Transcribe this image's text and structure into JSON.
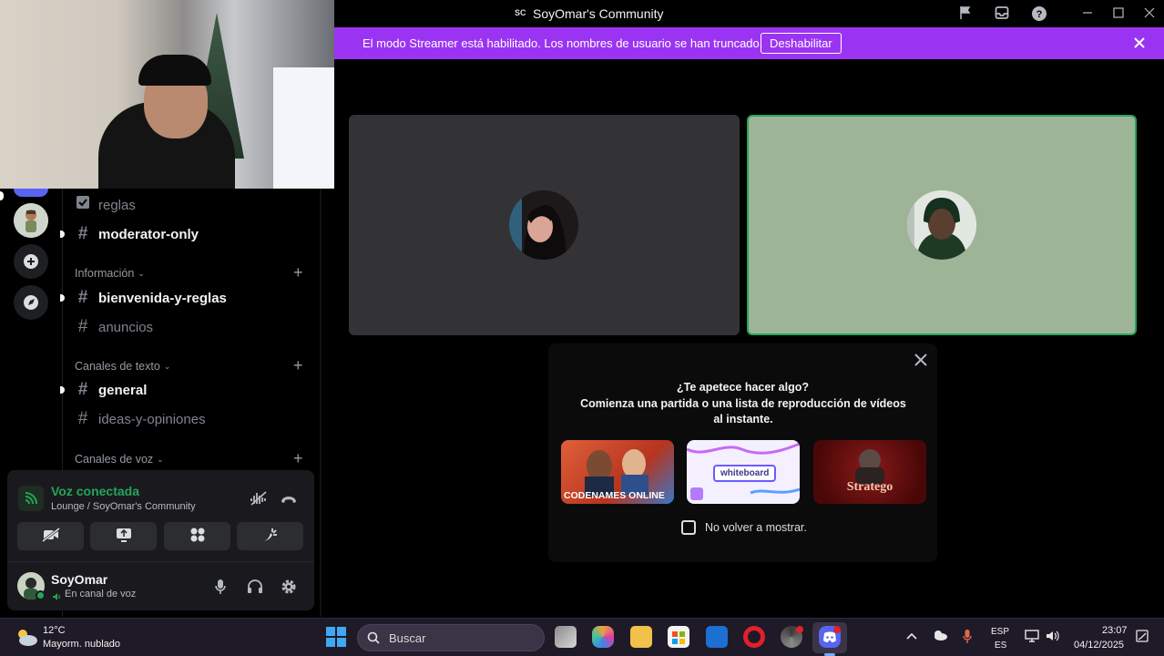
{
  "window": {
    "server_badge": "SC",
    "title": "SoyOmar's Community",
    "icons": [
      "flag-icon",
      "inbox-icon",
      "help-icon",
      "minimize-icon",
      "maximize-icon",
      "close-icon"
    ]
  },
  "banner": {
    "message": "El modo Streamer está habilitado. Los nombres de usuario se han truncado.",
    "button": "Deshabilitar",
    "close_icon": "close-icon"
  },
  "channels": {
    "top_items": [
      {
        "name": "reglas",
        "icon": "rules-icon",
        "unread": false
      },
      {
        "name": "moderator-only",
        "icon": "hash-icon",
        "unread": true
      }
    ],
    "categories": [
      {
        "label": "Información",
        "channels": [
          {
            "name": "bienvenida-y-reglas",
            "unread": true
          },
          {
            "name": "anuncios",
            "unread": false
          }
        ]
      },
      {
        "label": "Canales de texto",
        "channels": [
          {
            "name": "general",
            "unread": true
          },
          {
            "name": "ideas-y-opiniones",
            "unread": false
          }
        ]
      },
      {
        "label": "Canales de voz",
        "channels": []
      }
    ]
  },
  "voice": {
    "status": "Voz conectada",
    "location": "Lounge / SoyOmar's Community",
    "actions": [
      "camera-off-icon",
      "screen-share-icon",
      "activities-icon",
      "soundboard-icon"
    ]
  },
  "user": {
    "name": "SoyOmar",
    "status": "En canal de voz",
    "controls": [
      "microphone-icon",
      "headphones-icon",
      "settings-icon"
    ]
  },
  "popup": {
    "title": "¿Te apetece hacer algo?",
    "subtitle": "Comienza una partida o una lista de reproducción de vídeos al instante.",
    "games": [
      {
        "name": "CODENAMES ONLINE"
      },
      {
        "name": "whiteboard"
      },
      {
        "name": "Stratego"
      }
    ],
    "checkbox_label": "No volver a mostrar."
  },
  "taskbar": {
    "weather_temp": "12°C",
    "weather_desc": "Mayorm. nublado",
    "search_placeholder": "Buscar",
    "lang_top": "ESP",
    "lang_bottom": "ES",
    "time": "23:07",
    "date": "04/12/2025"
  },
  "colors": {
    "banner": "#9b34f2",
    "voice_green": "#23a55a",
    "speaking_tile": "#9db596",
    "blurple": "#5865f2"
  }
}
